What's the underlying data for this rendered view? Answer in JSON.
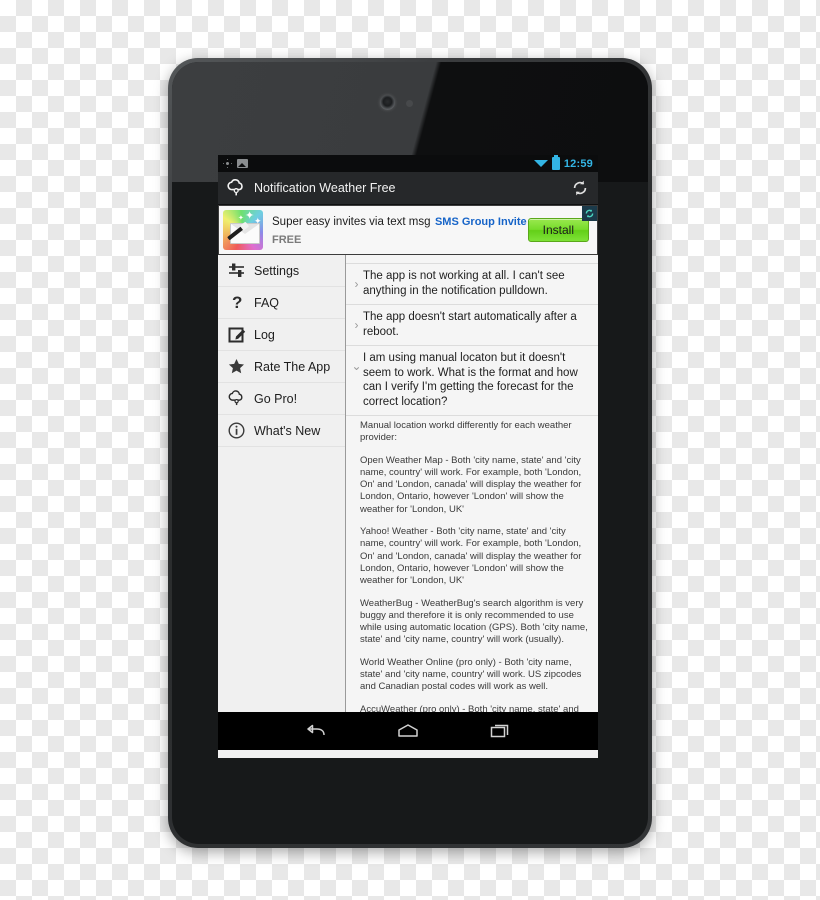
{
  "statusbar": {
    "icons": [
      "brightness-icon",
      "photo-icon",
      "wifi-icon",
      "battery-icon"
    ],
    "clock": "12:59",
    "accent_color": "#33b5e5"
  },
  "actionbar": {
    "logo_icon": "cloud-raindrop-logo",
    "title": "Notification Weather Free",
    "refresh_icon": "refresh-icon"
  },
  "ad": {
    "icon": "magic-envelope-icon",
    "headline": "Super easy invites via text msg",
    "app_name": "SMS Group Invite",
    "price": "FREE",
    "install_label": "Install",
    "badge_icon": "rotate-icon",
    "install_color": "#76dc2a"
  },
  "sidebar": {
    "items": [
      {
        "label": "Settings",
        "icon": "sliders-icon"
      },
      {
        "label": "FAQ",
        "icon": "question-mark-icon"
      },
      {
        "label": "Log",
        "icon": "pencil-square-icon"
      },
      {
        "label": "Rate The App",
        "icon": "star-icon"
      },
      {
        "label": "Go Pro!",
        "icon": "cloud-raindrop-icon"
      },
      {
        "label": "What's New",
        "icon": "info-circle-icon"
      }
    ]
  },
  "faq": {
    "items": [
      {
        "question": "The app is not working at all. I can't see anything in the notification pulldown.",
        "expanded": false,
        "chevron": "chevron-right-icon"
      },
      {
        "question": "The app doesn't start automatically after a reboot.",
        "expanded": false,
        "chevron": "chevron-right-icon"
      },
      {
        "question": "I am using manual locaton but it doesn't seem to work. What is the format and how can I verify I'm getting the forecast for the correct location?",
        "expanded": true,
        "chevron": "chevron-down-icon",
        "answer": [
          "Manual location workd differently for each weather provider:",
          "Open Weather Map - Both 'city name, state' and 'city name, country' will work. For example, both 'London, On' and 'London, canada' will display the weather for London, Ontario, however 'London' will show the weather for 'London, UK'",
          "Yahoo! Weather - Both 'city name, state' and 'city name, country' will work. For example, both 'London, On' and 'London, canada' will display the weather for London, Ontario, however 'London' will show the weather for 'London, UK'",
          "WeatherBug - WeatherBug's search algorithm is very buggy and therefore it is only recommended to use while using automatic location (GPS). Both 'city name, state' and 'city name, country' will work (usually).",
          "World Weather Online (pro only) - Both 'city name, state' and 'city name, country' will work. US zipcodes and Canadian postal codes will work as well.",
          "AccuWeather (pro only) - Both 'city name, state' and 'city name, country' will work. US zipcodes will work as well."
        ]
      }
    ]
  },
  "navbar": {
    "buttons": [
      {
        "name": "back-button",
        "icon": "back-arrow-icon"
      },
      {
        "name": "home-button",
        "icon": "home-icon"
      },
      {
        "name": "recents-button",
        "icon": "recents-icon"
      }
    ]
  }
}
